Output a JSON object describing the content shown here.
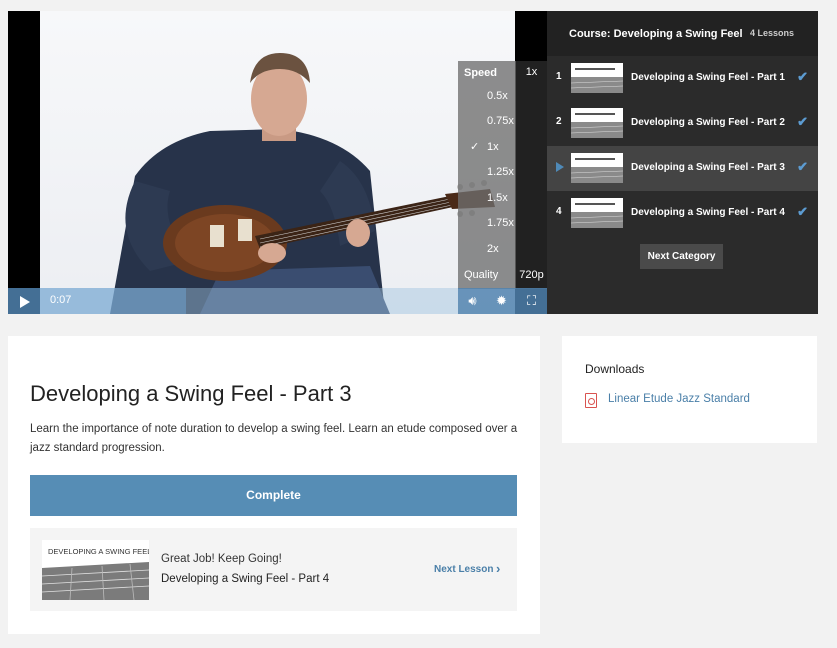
{
  "player": {
    "speed_menu": {
      "title": "Speed",
      "options": [
        "0.5x",
        "0.75x",
        "1x",
        "1.25x",
        "1.5x",
        "1.75x",
        "2x"
      ],
      "selected": "1x",
      "quality_label": "Quality"
    },
    "current_speed": "1x",
    "current_quality": "720p",
    "time": "0:07",
    "progress_fraction": 0.35,
    "controls": {
      "play_icon": "play-icon",
      "volume_icon": "volume-icon",
      "settings_icon": "gear-icon",
      "fullscreen_icon": "fullscreen-icon"
    }
  },
  "course": {
    "title": "Course: Developing a Swing Feel",
    "count": "4 Lessons",
    "lessons": [
      {
        "number": "1",
        "name": "Developing a Swing Feel - Part 1",
        "completed": true
      },
      {
        "number": "2",
        "name": "Developing a Swing Feel - Part 2",
        "completed": true
      },
      {
        "number": "",
        "name": "Developing a Swing Feel - Part 3",
        "completed": true,
        "active": true
      },
      {
        "number": "4",
        "name": "Developing a Swing Feel - Part 4",
        "completed": true
      }
    ],
    "next_category": "Next Category"
  },
  "main": {
    "title": "Developing a Swing Feel - Part 3",
    "description": "Learn the importance of note duration to develop a swing feel.  Learn an etude composed over a jazz standard progression.",
    "complete_label": "Complete",
    "next": {
      "thumb_text": "DEVELOPING A SWING FEEL",
      "cheer": "Great Job! Keep Going!",
      "lesson_name": "Developing a Swing Feel - Part 4",
      "link_label": "Next Lesson"
    }
  },
  "downloads": {
    "title": "Downloads",
    "items": [
      {
        "name": "Linear Etude Jazz Standard",
        "icon": "pdf-icon"
      }
    ]
  },
  "colors": {
    "accent": "#568db5",
    "check": "#5c9bd1",
    "link": "#4a7fa8",
    "pdf": "#d9534f"
  }
}
